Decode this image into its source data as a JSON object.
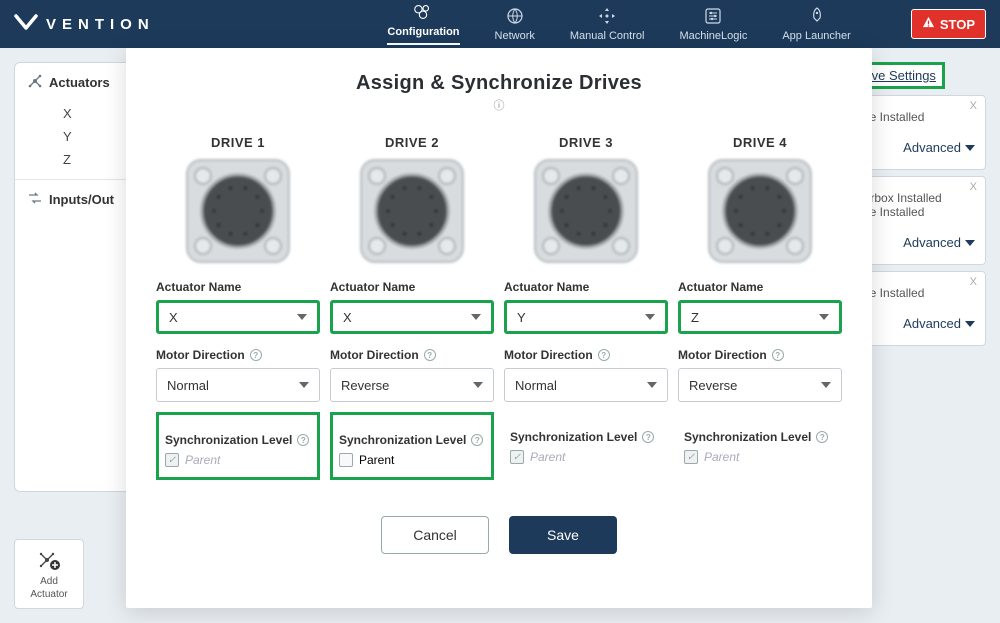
{
  "brand": "VENTION",
  "nav": {
    "items": [
      {
        "label": "Configuration",
        "icon": "gears"
      },
      {
        "label": "Network",
        "icon": "globe"
      },
      {
        "label": "Manual Control",
        "icon": "arrows"
      },
      {
        "label": "MachineLogic",
        "icon": "sliders"
      },
      {
        "label": "App Launcher",
        "icon": "rocket"
      }
    ],
    "stop": "STOP"
  },
  "sidebar": {
    "group1": {
      "label": "Actuators",
      "items": [
        "X",
        "Y",
        "Z"
      ]
    },
    "group2": {
      "label": "Inputs/Out"
    }
  },
  "right": {
    "drive_settings": "Drive Settings",
    "cards": [
      {
        "line1": "ake Installed",
        "advanced": "Advanced"
      },
      {
        "line1": "earbox Installed",
        "line2": "ake Installed",
        "advanced": "Advanced"
      },
      {
        "line1": "ake Installed",
        "advanced": "Advanced"
      }
    ]
  },
  "add": {
    "l1": "Add",
    "l2": "Actuator"
  },
  "modal": {
    "title": "Assign & Synchronize Drives",
    "drives": [
      {
        "title": "DRIVE 1",
        "actuator_label": "Actuator Name",
        "actuator": "X",
        "dir_label": "Motor Direction",
        "dir": "Normal",
        "sync_label": "Synchronization Level",
        "parent": "Parent",
        "parent_checked": true,
        "parent_disabled": true,
        "hl_actuator": true,
        "hl_sync": true
      },
      {
        "title": "DRIVE 2",
        "actuator_label": "Actuator Name",
        "actuator": "X",
        "dir_label": "Motor Direction",
        "dir": "Reverse",
        "sync_label": "Synchronization Level",
        "parent": "Parent",
        "parent_checked": false,
        "parent_disabled": false,
        "hl_actuator": true,
        "hl_sync": true
      },
      {
        "title": "DRIVE 3",
        "actuator_label": "Actuator Name",
        "actuator": "Y",
        "dir_label": "Motor Direction",
        "dir": "Normal",
        "sync_label": "Synchronization Level",
        "parent": "Parent",
        "parent_checked": true,
        "parent_disabled": true,
        "hl_actuator": true,
        "hl_sync": false
      },
      {
        "title": "DRIVE 4",
        "actuator_label": "Actuator Name",
        "actuator": "Z",
        "dir_label": "Motor Direction",
        "dir": "Reverse",
        "sync_label": "Synchronization Level",
        "parent": "Parent",
        "parent_checked": true,
        "parent_disabled": true,
        "hl_actuator": true,
        "hl_sync": false
      }
    ],
    "cancel": "Cancel",
    "save": "Save"
  }
}
